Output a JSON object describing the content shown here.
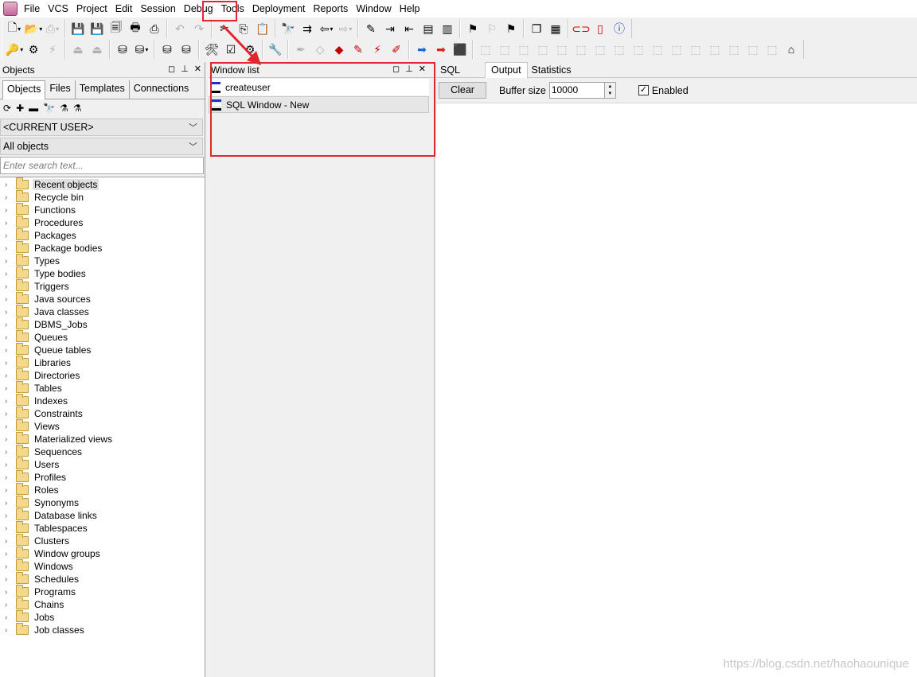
{
  "menu": [
    "File",
    "VCS",
    "Project",
    "Edit",
    "Session",
    "Debug",
    "Tools",
    "Deployment",
    "Reports",
    "Window",
    "Help"
  ],
  "objects_panel": {
    "title": "Objects",
    "tabs": [
      "Objects",
      "Files",
      "Templates",
      "Connections"
    ],
    "user_select": "<CURRENT USER>",
    "filter_select": "All objects",
    "search_placeholder": "Enter search text...",
    "tree": [
      "Recent objects",
      "Recycle bin",
      "Functions",
      "Procedures",
      "Packages",
      "Package bodies",
      "Types",
      "Type bodies",
      "Triggers",
      "Java sources",
      "Java classes",
      "DBMS_Jobs",
      "Queues",
      "Queue tables",
      "Libraries",
      "Directories",
      "Tables",
      "Indexes",
      "Constraints",
      "Views",
      "Materialized views",
      "Sequences",
      "Users",
      "Profiles",
      "Roles",
      "Synonyms",
      "Database links",
      "Tablespaces",
      "Clusters",
      "Window groups",
      "Windows",
      "Schedules",
      "Programs",
      "Chains",
      "Jobs",
      "Job classes"
    ]
  },
  "window_list": {
    "title": "Window list",
    "items": [
      "createuser",
      "SQL Window - New"
    ]
  },
  "right_tabs": [
    "SQL",
    "Output",
    "Statistics"
  ],
  "output": {
    "clear_label": "Clear",
    "buffer_label": "Buffer size",
    "buffer_value": "10000",
    "enabled_label": "Enabled",
    "enabled": true
  },
  "watermark": "https://blog.csdn.net/haohaounique",
  "colors": {
    "highlight": "#e0262e"
  }
}
